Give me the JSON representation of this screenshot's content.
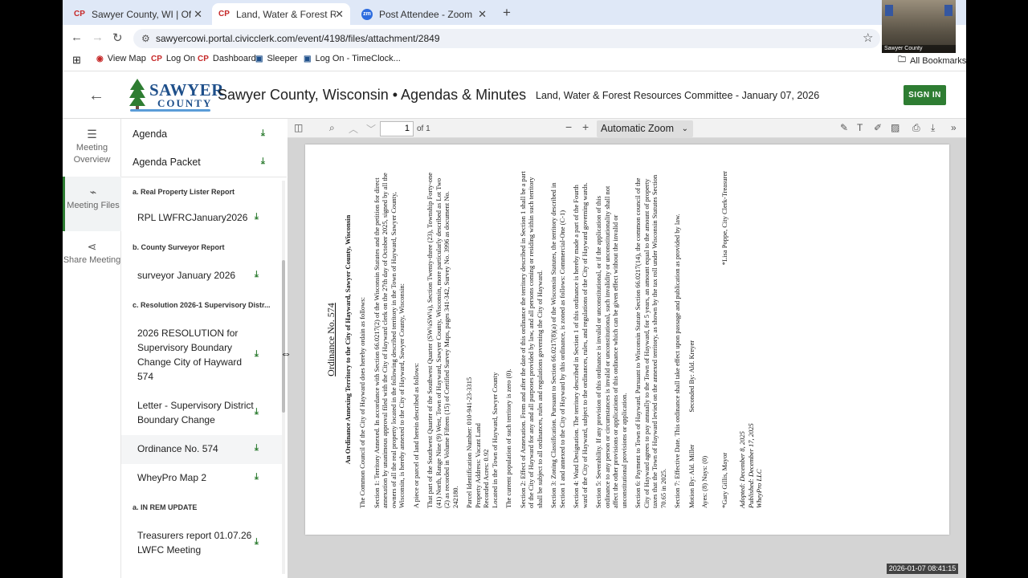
{
  "browser": {
    "tabs": [
      {
        "label": "Sawyer County, WI | Official Website",
        "fav": "CP",
        "fav_color": "#c62828"
      },
      {
        "label": "Land, Water & Forest Resources",
        "fav": "CP",
        "fav_color": "#c62828"
      },
      {
        "label": "Post Attendee - Zoom",
        "fav": "zm",
        "fav_color": "#2d6cdf"
      }
    ],
    "url": "sawyercowi.portal.civicclerk.com/event/4198/files/attachment/2849",
    "bookmarks": [
      "View Map",
      "Log On",
      "Dashboard",
      "Sleeper",
      "Log On - TimeClock...",
      "All Bookmarks"
    ]
  },
  "header": {
    "logo_line1": "SAWYER",
    "logo_line2": "COUNTY",
    "site_title": "Sawyer County, Wisconsin • Agendas & Minutes",
    "meeting_title": "Land, Water & Forest Resources Committee - January 07, 2026",
    "sign_in": "SIGN IN"
  },
  "rail": {
    "overview": "Meeting Overview",
    "files": "Meeting Files",
    "share": "Share Meeting"
  },
  "files": {
    "agenda": "Agenda",
    "agenda_packet": "Agenda Packet",
    "sections": [
      {
        "header": "a. Real Property Lister Report",
        "items": [
          "RPL LWFRCJanuary2026"
        ]
      },
      {
        "header": "b. County Surveyor Report",
        "items": [
          "surveyor January 2026"
        ]
      },
      {
        "header": "c. Resolution 2026-1 Supervisory Distr...",
        "items": [
          "2026 RESOLUTION for Supervisory Boundary Change City of Hayward 574",
          "Letter - Supervisory District Boundary Change",
          "Ordinance No. 574",
          "WheyPro Map 2"
        ]
      },
      {
        "header": "a. IN REM UPDATE",
        "items": [
          "Treasurers report 01.07.26 LWFC Meeting"
        ]
      }
    ]
  },
  "pdf": {
    "page": "1",
    "of": "of 1",
    "zoom": "Automatic Zoom",
    "doc": {
      "title": "Ordinance No. 574",
      "subtitle": "An Ordinance Annexing Territory to the City of Hayward, Sawyer County, Wisconsin",
      "intro": "The Common Council of the City of Hayward does hereby ordain as follows:",
      "s1": "Section 1: Territory Annexed. In accordance with Section 66.0217(2) of the Wisconsin Statutes and the petition for direct annexation by unanimous approval filed with the City of Hayward clerk on the 27th day of October 2025, signed by all the owners of all the real property located in the following described territory in the Town of Hayward, Sawyer County, Wisconsin, is hereby annexed to the City of Hayward, Sawyer County, Wisconsin:",
      "parcel": "A piece or parcel of land herein described as follows:",
      "legal": "That part of the Southwest Quarter of the Southwest Quarter (SW¼SW¼), Section Twenty-three (23), Township Forty-one (41) North, Range Nine (9) West, Town of Hayward, Sawyer County, Wisconsin, more particularly described as Lot Two (2) as recorded in Volume Fifteen (15) of Certified Survey Maps, pages 341-342, Survey No. 3996 as document No. 242180.",
      "pid": "Parcel Identification Number: 010-941-23-3315",
      "addr": "Property Address: Vacant Land",
      "acres": "Recorded Acres: 0.92",
      "loc": "Located in the Town of Hayward, Sawyer County",
      "pop": "The current population of such territory is zero (0).",
      "s2": "Section 2: Effect of Annexation. From and after the date of this ordinance the territory described in Section 1 shall be a part of the City of Hayward for any and all purposes provided by law, and all persons coming or residing within such territory shall be subject to all ordinances, rules and regulations governing the City of Hayward.",
      "s3": "Section 3: Zoning Classification. Pursuant to Section 66.0217(8)(a) of the Wisconsin Statutes, the territory described in Section 1 and annexed to the City of Hayward by this ordinance, is zoned as follows: Commercial-One (C-1)",
      "s4": "Section 4: Ward Designation. The territory described in Section 1 of this ordinance is hereby made a part of the Fourth ward of the City of Hayward, subject to the ordinances, rules, and regulations of the City of Hayward governing wards.",
      "s5": "Section 5: Severability. If any provision of this ordinance is invalid or unconstitutional, or if the application of this ordinance to any person or circumstances is invalid or unconstitutional, such invalidity or unconstitutionality shall not affect the other provisions or applications of this ordinance which can be given effect without the invalid or unconstitutional provisions or application.",
      "s6": "Section 6: Payment to Town of Hayward. Pursuant to Wisconsin Statute Section 66.0217(14), the common council of the City of Hayward agrees to pay annually to the Town of Hayward, for 5 years, an amount equal to the amount of property taxes that the Town of Hayward levied on the annexed territory, as shown by the tax roll under Wisconsin Statutes Section 70.65 in 2025.",
      "s7": "Section 7: Effective Date. This ordinance shall take effect upon passage and publication as provided by law.",
      "motion": "Motion By: Ald. Miller",
      "second": "Seconded By: Ald. Kreyer",
      "ayes": "Ayes: (8)  Nays: (0)",
      "mayor": "*Gary Gillis, Mayor",
      "clerk": "*Lisa Poppe, City Clerk-Treasurer",
      "adopted": "Adopted: December 8, 2025",
      "published": "Published: December 17, 2025",
      "whey": "WheyPro LLC"
    }
  },
  "overlay": {
    "pip_label": "Sawyer County",
    "timestamp": "2026-01-07  08:41:15"
  }
}
